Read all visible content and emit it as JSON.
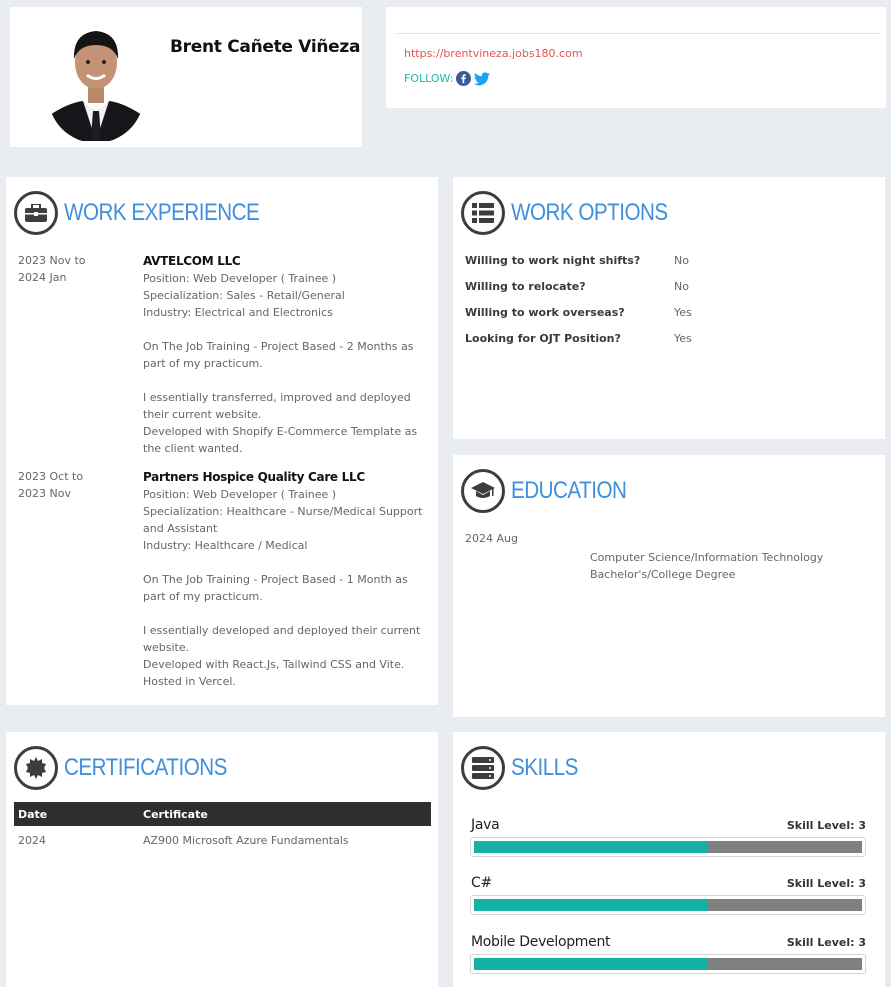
{
  "profile": {
    "name": "Brent Cañete Viñeza",
    "url": "https://brentvineza.jobs180.com",
    "follow_label": "FOLLOW:",
    "social_icons": [
      "facebook-icon",
      "twitter-icon"
    ]
  },
  "work_experience": {
    "title": "WORK EXPERIENCE",
    "jobs": [
      {
        "date_from": "2023 Nov to",
        "date_to": "2024 Jan",
        "company": "AVTELCOM LLC",
        "position": "Position: Web Developer ( Trainee )",
        "specialization": "Specialization: Sales - Retail/General",
        "industry": "Industry: Electrical and Electronics",
        "desc1": "On The Job Training - Project Based - 2 Months as part of my practicum.",
        "desc2": "I essentially transferred, improved and deployed their current website.",
        "desc3": "Developed with Shopify E-Commerce Template as the client wanted."
      },
      {
        "date_from": "2023 Oct to",
        "date_to": "2023 Nov",
        "company": "Partners Hospice Quality Care LLC",
        "position": "Position: Web Developer ( Trainee )",
        "specialization": "Specialization: Healthcare - Nurse/Medical Support and Assistant",
        "industry": "Industry: Healthcare / Medical",
        "desc1": "On The Job Training - Project Based - 1 Month as part of my practicum.",
        "desc2": "I essentially developed and deployed their current website.",
        "desc3": "Developed with React.Js, Tailwind CSS and Vite.",
        "desc4": "Hosted in Vercel."
      }
    ]
  },
  "work_options": {
    "title": "WORK OPTIONS",
    "rows": [
      {
        "q": "Willing to work night shifts?",
        "a": "No"
      },
      {
        "q": "Willing to relocate?",
        "a": "No"
      },
      {
        "q": "Willing to work overseas?",
        "a": "Yes"
      },
      {
        "q": "Looking for OJT Position?",
        "a": "Yes"
      }
    ]
  },
  "education": {
    "title": "EDUCATION",
    "date": "2024 Aug",
    "field": "Computer Science/Information Technology",
    "degree": "Bachelor's/College Degree"
  },
  "certifications": {
    "title": "CERTIFICATIONS",
    "col_date": "Date",
    "col_cert": "Certificate",
    "rows": [
      {
        "date": "2024",
        "cert": "AZ900 Microsoft Azure Fundamentals"
      }
    ]
  },
  "skills": {
    "title": "SKILLS",
    "level_label": "Skill Level: 3",
    "items": [
      {
        "name": "Java",
        "level": 3,
        "fill_fraction": 0.6
      },
      {
        "name": "C#",
        "level": 3,
        "fill_fraction": 0.6
      },
      {
        "name": "Mobile Development",
        "level": 3,
        "fill_fraction": 0.6
      }
    ]
  },
  "colors": {
    "accent_blue": "#3f8fdd",
    "link_red": "#e2564f",
    "teal": "#14b2a5",
    "facebook": "#3b5998",
    "twitter": "#1da1f2"
  }
}
